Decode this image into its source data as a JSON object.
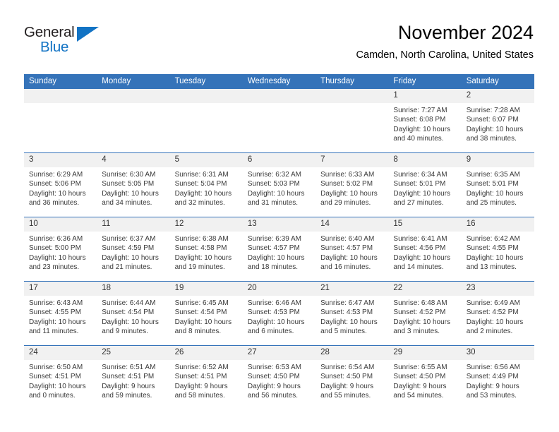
{
  "brand": {
    "name_part1": "General",
    "name_part2": "Blue",
    "accent_color": "#1273c4",
    "triangle_icon": "triangle-icon"
  },
  "header": {
    "title": "November 2024",
    "location": "Camden, North Carolina, United States"
  },
  "calendar": {
    "header_bg": "#3573b9",
    "daynum_bg": "#f1f1f1",
    "weekdays": [
      "Sunday",
      "Monday",
      "Tuesday",
      "Wednesday",
      "Thursday",
      "Friday",
      "Saturday"
    ],
    "weeks": [
      [
        {
          "day": "",
          "sunrise": "",
          "sunset": "",
          "daylight_line1": "",
          "daylight_line2": "",
          "blank": true
        },
        {
          "day": "",
          "sunrise": "",
          "sunset": "",
          "daylight_line1": "",
          "daylight_line2": "",
          "blank": true
        },
        {
          "day": "",
          "sunrise": "",
          "sunset": "",
          "daylight_line1": "",
          "daylight_line2": "",
          "blank": true
        },
        {
          "day": "",
          "sunrise": "",
          "sunset": "",
          "daylight_line1": "",
          "daylight_line2": "",
          "blank": true
        },
        {
          "day": "",
          "sunrise": "",
          "sunset": "",
          "daylight_line1": "",
          "daylight_line2": "",
          "blank": true
        },
        {
          "day": "1",
          "sunrise": "Sunrise: 7:27 AM",
          "sunset": "Sunset: 6:08 PM",
          "daylight_line1": "Daylight: 10 hours",
          "daylight_line2": "and 40 minutes.",
          "blank": false
        },
        {
          "day": "2",
          "sunrise": "Sunrise: 7:28 AM",
          "sunset": "Sunset: 6:07 PM",
          "daylight_line1": "Daylight: 10 hours",
          "daylight_line2": "and 38 minutes.",
          "blank": false
        }
      ],
      [
        {
          "day": "3",
          "sunrise": "Sunrise: 6:29 AM",
          "sunset": "Sunset: 5:06 PM",
          "daylight_line1": "Daylight: 10 hours",
          "daylight_line2": "and 36 minutes.",
          "blank": false
        },
        {
          "day": "4",
          "sunrise": "Sunrise: 6:30 AM",
          "sunset": "Sunset: 5:05 PM",
          "daylight_line1": "Daylight: 10 hours",
          "daylight_line2": "and 34 minutes.",
          "blank": false
        },
        {
          "day": "5",
          "sunrise": "Sunrise: 6:31 AM",
          "sunset": "Sunset: 5:04 PM",
          "daylight_line1": "Daylight: 10 hours",
          "daylight_line2": "and 32 minutes.",
          "blank": false
        },
        {
          "day": "6",
          "sunrise": "Sunrise: 6:32 AM",
          "sunset": "Sunset: 5:03 PM",
          "daylight_line1": "Daylight: 10 hours",
          "daylight_line2": "and 31 minutes.",
          "blank": false
        },
        {
          "day": "7",
          "sunrise": "Sunrise: 6:33 AM",
          "sunset": "Sunset: 5:02 PM",
          "daylight_line1": "Daylight: 10 hours",
          "daylight_line2": "and 29 minutes.",
          "blank": false
        },
        {
          "day": "8",
          "sunrise": "Sunrise: 6:34 AM",
          "sunset": "Sunset: 5:01 PM",
          "daylight_line1": "Daylight: 10 hours",
          "daylight_line2": "and 27 minutes.",
          "blank": false
        },
        {
          "day": "9",
          "sunrise": "Sunrise: 6:35 AM",
          "sunset": "Sunset: 5:01 PM",
          "daylight_line1": "Daylight: 10 hours",
          "daylight_line2": "and 25 minutes.",
          "blank": false
        }
      ],
      [
        {
          "day": "10",
          "sunrise": "Sunrise: 6:36 AM",
          "sunset": "Sunset: 5:00 PM",
          "daylight_line1": "Daylight: 10 hours",
          "daylight_line2": "and 23 minutes.",
          "blank": false
        },
        {
          "day": "11",
          "sunrise": "Sunrise: 6:37 AM",
          "sunset": "Sunset: 4:59 PM",
          "daylight_line1": "Daylight: 10 hours",
          "daylight_line2": "and 21 minutes.",
          "blank": false
        },
        {
          "day": "12",
          "sunrise": "Sunrise: 6:38 AM",
          "sunset": "Sunset: 4:58 PM",
          "daylight_line1": "Daylight: 10 hours",
          "daylight_line2": "and 19 minutes.",
          "blank": false
        },
        {
          "day": "13",
          "sunrise": "Sunrise: 6:39 AM",
          "sunset": "Sunset: 4:57 PM",
          "daylight_line1": "Daylight: 10 hours",
          "daylight_line2": "and 18 minutes.",
          "blank": false
        },
        {
          "day": "14",
          "sunrise": "Sunrise: 6:40 AM",
          "sunset": "Sunset: 4:57 PM",
          "daylight_line1": "Daylight: 10 hours",
          "daylight_line2": "and 16 minutes.",
          "blank": false
        },
        {
          "day": "15",
          "sunrise": "Sunrise: 6:41 AM",
          "sunset": "Sunset: 4:56 PM",
          "daylight_line1": "Daylight: 10 hours",
          "daylight_line2": "and 14 minutes.",
          "blank": false
        },
        {
          "day": "16",
          "sunrise": "Sunrise: 6:42 AM",
          "sunset": "Sunset: 4:55 PM",
          "daylight_line1": "Daylight: 10 hours",
          "daylight_line2": "and 13 minutes.",
          "blank": false
        }
      ],
      [
        {
          "day": "17",
          "sunrise": "Sunrise: 6:43 AM",
          "sunset": "Sunset: 4:55 PM",
          "daylight_line1": "Daylight: 10 hours",
          "daylight_line2": "and 11 minutes.",
          "blank": false
        },
        {
          "day": "18",
          "sunrise": "Sunrise: 6:44 AM",
          "sunset": "Sunset: 4:54 PM",
          "daylight_line1": "Daylight: 10 hours",
          "daylight_line2": "and 9 minutes.",
          "blank": false
        },
        {
          "day": "19",
          "sunrise": "Sunrise: 6:45 AM",
          "sunset": "Sunset: 4:54 PM",
          "daylight_line1": "Daylight: 10 hours",
          "daylight_line2": "and 8 minutes.",
          "blank": false
        },
        {
          "day": "20",
          "sunrise": "Sunrise: 6:46 AM",
          "sunset": "Sunset: 4:53 PM",
          "daylight_line1": "Daylight: 10 hours",
          "daylight_line2": "and 6 minutes.",
          "blank": false
        },
        {
          "day": "21",
          "sunrise": "Sunrise: 6:47 AM",
          "sunset": "Sunset: 4:53 PM",
          "daylight_line1": "Daylight: 10 hours",
          "daylight_line2": "and 5 minutes.",
          "blank": false
        },
        {
          "day": "22",
          "sunrise": "Sunrise: 6:48 AM",
          "sunset": "Sunset: 4:52 PM",
          "daylight_line1": "Daylight: 10 hours",
          "daylight_line2": "and 3 minutes.",
          "blank": false
        },
        {
          "day": "23",
          "sunrise": "Sunrise: 6:49 AM",
          "sunset": "Sunset: 4:52 PM",
          "daylight_line1": "Daylight: 10 hours",
          "daylight_line2": "and 2 minutes.",
          "blank": false
        }
      ],
      [
        {
          "day": "24",
          "sunrise": "Sunrise: 6:50 AM",
          "sunset": "Sunset: 4:51 PM",
          "daylight_line1": "Daylight: 10 hours",
          "daylight_line2": "and 0 minutes.",
          "blank": false
        },
        {
          "day": "25",
          "sunrise": "Sunrise: 6:51 AM",
          "sunset": "Sunset: 4:51 PM",
          "daylight_line1": "Daylight: 9 hours",
          "daylight_line2": "and 59 minutes.",
          "blank": false
        },
        {
          "day": "26",
          "sunrise": "Sunrise: 6:52 AM",
          "sunset": "Sunset: 4:51 PM",
          "daylight_line1": "Daylight: 9 hours",
          "daylight_line2": "and 58 minutes.",
          "blank": false
        },
        {
          "day": "27",
          "sunrise": "Sunrise: 6:53 AM",
          "sunset": "Sunset: 4:50 PM",
          "daylight_line1": "Daylight: 9 hours",
          "daylight_line2": "and 56 minutes.",
          "blank": false
        },
        {
          "day": "28",
          "sunrise": "Sunrise: 6:54 AM",
          "sunset": "Sunset: 4:50 PM",
          "daylight_line1": "Daylight: 9 hours",
          "daylight_line2": "and 55 minutes.",
          "blank": false
        },
        {
          "day": "29",
          "sunrise": "Sunrise: 6:55 AM",
          "sunset": "Sunset: 4:50 PM",
          "daylight_line1": "Daylight: 9 hours",
          "daylight_line2": "and 54 minutes.",
          "blank": false
        },
        {
          "day": "30",
          "sunrise": "Sunrise: 6:56 AM",
          "sunset": "Sunset: 4:49 PM",
          "daylight_line1": "Daylight: 9 hours",
          "daylight_line2": "and 53 minutes.",
          "blank": false
        }
      ]
    ]
  }
}
